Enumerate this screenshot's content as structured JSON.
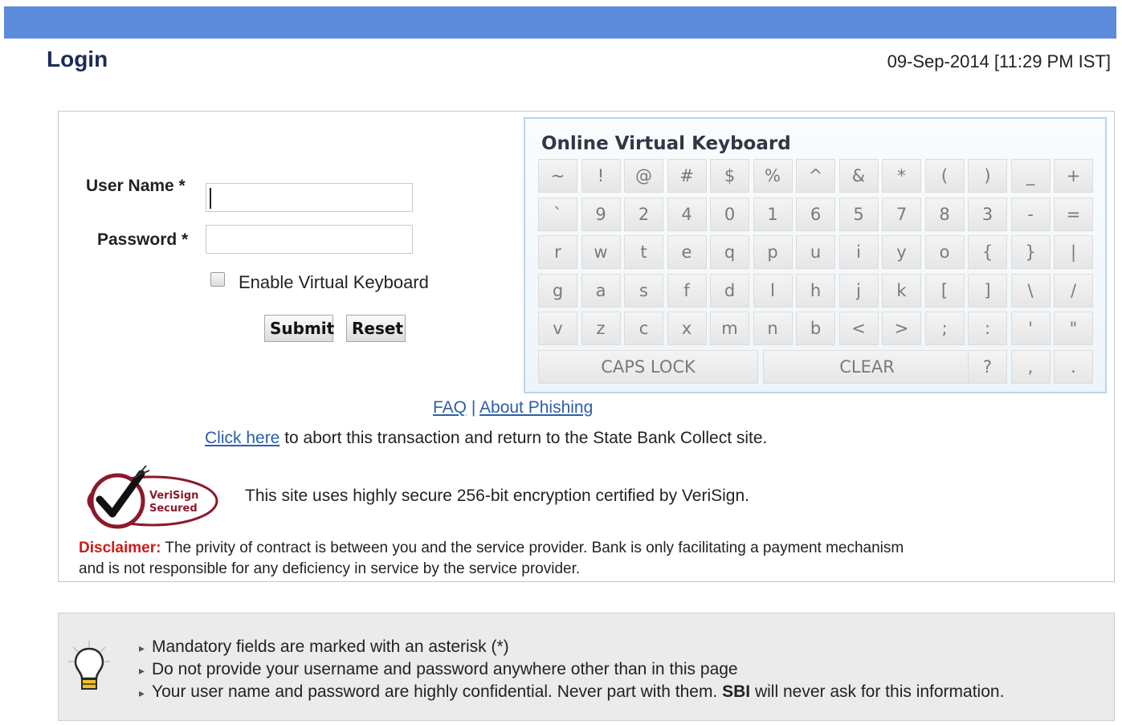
{
  "header": {
    "title": "Login",
    "datetime": "09-Sep-2014 [11:29 PM IST]"
  },
  "form": {
    "username_label": "User Name *",
    "password_label": "Password *",
    "username_value": "",
    "password_value": "",
    "virtual_keyboard_label": "Enable Virtual Keyboard",
    "virtual_keyboard_checked": false,
    "submit_label": "Submit",
    "reset_label": "Reset"
  },
  "virtual_keyboard": {
    "title": "Online Virtual Keyboard",
    "rows": [
      [
        "~",
        "!",
        "@",
        "#",
        "$",
        "%",
        "^",
        "&",
        "*",
        "(",
        ")",
        "_",
        "+"
      ],
      [
        "`",
        "9",
        "2",
        "4",
        "0",
        "1",
        "6",
        "5",
        "7",
        "8",
        "3",
        "-",
        "="
      ],
      [
        "r",
        "w",
        "t",
        "e",
        "q",
        "p",
        "u",
        "i",
        "y",
        "o",
        "{",
        "}",
        "|"
      ],
      [
        "g",
        "a",
        "s",
        "f",
        "d",
        "l",
        "h",
        "j",
        "k",
        "[",
        "]",
        "\\",
        "/"
      ],
      [
        "v",
        "z",
        "c",
        "x",
        "m",
        "n",
        "b",
        "<",
        ">",
        ";",
        ":",
        "'",
        "\""
      ]
    ],
    "caps_lock_label": "CAPS LOCK",
    "clear_label": "CLEAR",
    "last_row_keys": [
      "?",
      ",",
      "."
    ]
  },
  "links": {
    "faq": "FAQ",
    "separator": "|",
    "about_phishing": "About Phishing",
    "click_here": "Click here",
    "abort_text": " to abort this transaction and return to the State Bank Collect site."
  },
  "security": {
    "badge_line1": "VeriSign",
    "badge_line2": "Secured",
    "text": "This site uses highly secure 256-bit encryption certified by VeriSign."
  },
  "disclaimer": {
    "label": "Disclaimer:",
    "text": " The privity of contract is between you and the service provider. Bank is only facilitating a payment mechanism and is not responsible for any deficiency in service by the service provider."
  },
  "tips": {
    "icon": "lightbulb-icon",
    "items": [
      "Mandatory fields are marked with an asterisk (*)",
      "Do not provide your username and password anywhere other than in this page"
    ],
    "item3_prefix": "Your user name and password are highly confidential. Never part with them. ",
    "item3_bold": "SBI",
    "item3_suffix": " will never ask for this information."
  },
  "colors": {
    "topbar": "#5d8bdb",
    "title": "#1d2a5a",
    "link": "#2c5ea8",
    "disclaimer_label": "#d01a1a"
  }
}
